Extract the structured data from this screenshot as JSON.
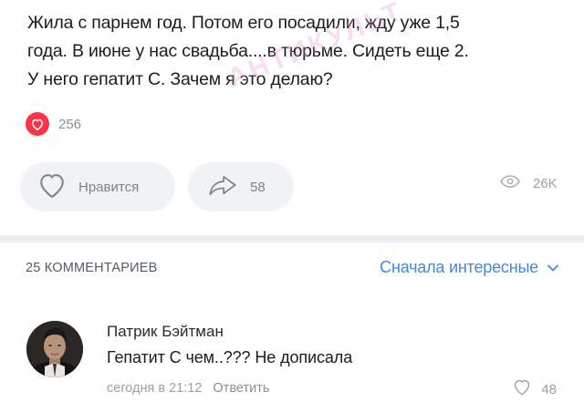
{
  "post": {
    "lines": [
      "Жила с парнем год. Потом его посадили, жду уже 1,5",
      "года. В июне у нас свадьба....в тюрьме. Сидеть еще 2.",
      "У него гепатит С. Зачем я это делаю?"
    ],
    "reaction_count": "256",
    "watermark": "АНТИКУЛЬТ"
  },
  "actions": {
    "like_label": "Нравится",
    "share_count": "58",
    "views_count": "26K"
  },
  "comments": {
    "count_label": "25 КОММЕНТАРИЕВ",
    "sort_label": "Сначала интересные",
    "items": [
      {
        "author": "Патрик Бэйтман",
        "text": "Гепатит С чем..??? Не дописала",
        "time": "сегодня в 21:12",
        "reply_label": "Ответить",
        "like_count": "48"
      }
    ]
  },
  "colors": {
    "accent": "#3f8ae0",
    "reaction_red": "#ff3347",
    "pill_bg": "#f0f2f5",
    "secondary_text": "#8a8f96"
  }
}
